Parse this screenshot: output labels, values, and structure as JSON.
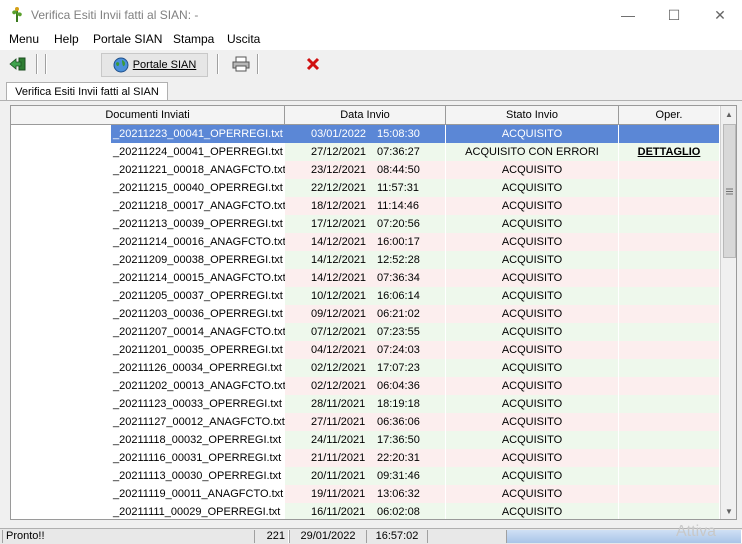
{
  "window": {
    "title": "Verifica Esiti Invii fatti al SIAN: -",
    "minimize_glyph": "—",
    "maximize_glyph": "☐",
    "close_glyph": "✕"
  },
  "menu": [
    "Menu",
    "Help",
    "Portale SIAN",
    "Stampa",
    "Uscita"
  ],
  "toolbar": {
    "portale_label": "Portale SIAN",
    "icons": [
      "back-arrow-icon",
      "globe-icon",
      "printer-icon",
      "red-x-icon"
    ]
  },
  "tab": {
    "label": "Verifica Esiti Invii fatti al SIAN"
  },
  "table": {
    "headers": [
      "Documenti Inviati",
      "Data Invio",
      "Stato Invio",
      "Oper."
    ],
    "rows": [
      {
        "doc": "_20211223_00041_OPERREGI.txt",
        "date": "03/01/2022",
        "time": "15:08:30",
        "stato": "ACQUISITO",
        "oper": ""
      },
      {
        "doc": "_20211224_00041_OPERREGI.txt",
        "date": "27/12/2021",
        "time": "07:36:27",
        "stato": "ACQUISITO CON ERRORI",
        "oper": "DETTAGLIO"
      },
      {
        "doc": "_20211221_00018_ANAGFCTO.txt",
        "date": "23/12/2021",
        "time": "08:44:50",
        "stato": "ACQUISITO",
        "oper": ""
      },
      {
        "doc": "_20211215_00040_OPERREGI.txt",
        "date": "22/12/2021",
        "time": "11:57:31",
        "stato": "ACQUISITO",
        "oper": ""
      },
      {
        "doc": "_20211218_00017_ANAGFCTO.txt",
        "date": "18/12/2021",
        "time": "11:14:46",
        "stato": "ACQUISITO",
        "oper": ""
      },
      {
        "doc": "_20211213_00039_OPERREGI.txt",
        "date": "17/12/2021",
        "time": "07:20:56",
        "stato": "ACQUISITO",
        "oper": ""
      },
      {
        "doc": "_20211214_00016_ANAGFCTO.txt",
        "date": "14/12/2021",
        "time": "16:00:17",
        "stato": "ACQUISITO",
        "oper": ""
      },
      {
        "doc": "_20211209_00038_OPERREGI.txt",
        "date": "14/12/2021",
        "time": "12:52:28",
        "stato": "ACQUISITO",
        "oper": ""
      },
      {
        "doc": "_20211214_00015_ANAGFCTO.txt",
        "date": "14/12/2021",
        "time": "07:36:34",
        "stato": "ACQUISITO",
        "oper": ""
      },
      {
        "doc": "_20211205_00037_OPERREGI.txt",
        "date": "10/12/2021",
        "time": "16:06:14",
        "stato": "ACQUISITO",
        "oper": ""
      },
      {
        "doc": "_20211203_00036_OPERREGI.txt",
        "date": "09/12/2021",
        "time": "06:21:02",
        "stato": "ACQUISITO",
        "oper": ""
      },
      {
        "doc": "_20211207_00014_ANAGFCTO.txt",
        "date": "07/12/2021",
        "time": "07:23:55",
        "stato": "ACQUISITO",
        "oper": ""
      },
      {
        "doc": "_20211201_00035_OPERREGI.txt",
        "date": "04/12/2021",
        "time": "07:24:03",
        "stato": "ACQUISITO",
        "oper": ""
      },
      {
        "doc": "_20211126_00034_OPERREGI.txt",
        "date": "02/12/2021",
        "time": "17:07:23",
        "stato": "ACQUISITO",
        "oper": ""
      },
      {
        "doc": "_20211202_00013_ANAGFCTO.txt",
        "date": "02/12/2021",
        "time": "06:04:36",
        "stato": "ACQUISITO",
        "oper": ""
      },
      {
        "doc": "_20211123_00033_OPERREGI.txt",
        "date": "28/11/2021",
        "time": "18:19:18",
        "stato": "ACQUISITO",
        "oper": ""
      },
      {
        "doc": "_20211127_00012_ANAGFCTO.txt",
        "date": "27/11/2021",
        "time": "06:36:06",
        "stato": "ACQUISITO",
        "oper": ""
      },
      {
        "doc": "_20211118_00032_OPERREGI.txt",
        "date": "24/11/2021",
        "time": "17:36:50",
        "stato": "ACQUISITO",
        "oper": ""
      },
      {
        "doc": "_20211116_00031_OPERREGI.txt",
        "date": "21/11/2021",
        "time": "22:20:31",
        "stato": "ACQUISITO",
        "oper": ""
      },
      {
        "doc": "_20211113_00030_OPERREGI.txt",
        "date": "20/11/2021",
        "time": "09:31:46",
        "stato": "ACQUISITO",
        "oper": ""
      },
      {
        "doc": "_20211119_00011_ANAGFCTO.txt",
        "date": "19/11/2021",
        "time": "13:06:32",
        "stato": "ACQUISITO",
        "oper": ""
      },
      {
        "doc": "_20211111_00029_OPERREGI.txt",
        "date": "16/11/2021",
        "time": "06:02:08",
        "stato": "ACQUISITO",
        "oper": ""
      }
    ],
    "row_colors": {
      "odd": "#ffffff",
      "green": "#eef8ec",
      "pink": "#fceeee",
      "selected": "#5b87d6"
    }
  },
  "status": {
    "message": "Pronto!!",
    "count": "221",
    "date": "29/01/2022",
    "time": "16:57:02"
  },
  "watermark": "Attiva"
}
